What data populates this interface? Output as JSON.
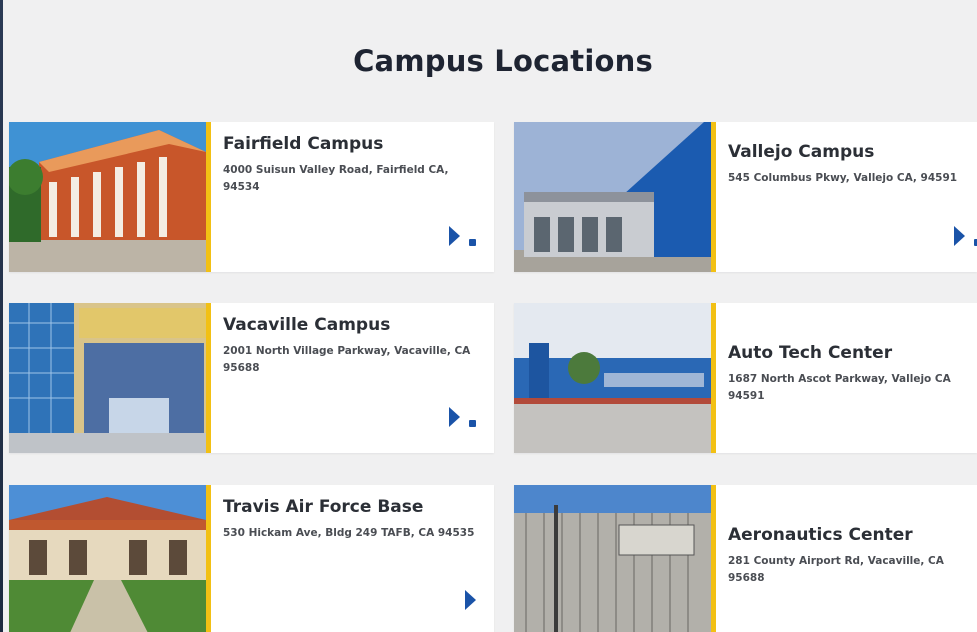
{
  "page": {
    "title": "Campus Locations"
  },
  "locations": [
    {
      "name": "Fairfield Campus",
      "address": "4000 Suisun Valley Road, Fairfield CA, 94534"
    },
    {
      "name": "Vallejo Campus",
      "address": "545 Columbus Pkwy, Vallejo CA, 94591"
    },
    {
      "name": "Vacaville Campus",
      "address": "2001 North Village Parkway, Vacaville, CA 95688"
    },
    {
      "name": "Auto Tech Center",
      "address": "1687 North Ascot Parkway, Vallejo CA 94591"
    },
    {
      "name": "Travis Air Force Base",
      "address": "530 Hickam Ave, Bldg 249 TAFB, CA 94535"
    },
    {
      "name": "Aeronautics Center",
      "address": "281 County Airport Rd, Vacaville, CA 95688"
    }
  ],
  "icons": {
    "next": "play-arrow-icon",
    "detail": "square-icon"
  },
  "colors": {
    "accent": "#f2c014",
    "link": "#1a53a8",
    "heading": "#1e2432"
  }
}
